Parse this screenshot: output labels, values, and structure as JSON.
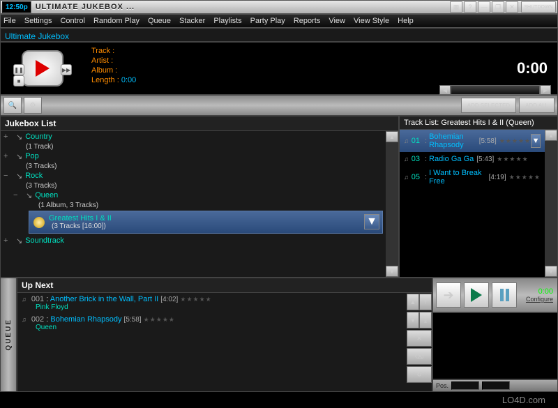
{
  "titlebar": {
    "clock": "12:50p",
    "app_title": "ULTIMATE JUKEBOX ...",
    "shutdown": "SHUTDOWN"
  },
  "menubar": {
    "items": [
      "File",
      "Settings",
      "Control",
      "Random Play",
      "Queue",
      "Stacker",
      "Playlists",
      "Party Play",
      "Reports",
      "View",
      "View Style",
      "Help"
    ]
  },
  "subbar": {
    "title": "Ultimate Jukebox"
  },
  "nowplaying": {
    "track_label": "Track :",
    "artist_label": "Artist :",
    "album_label": "Album :",
    "length_label": "Length :",
    "length_value": "0:00",
    "time_display": "0:00"
  },
  "toolbar": {
    "add_selected": "ADD SELECTED",
    "add_all": "ADD ALL"
  },
  "jukebox": {
    "header": "Jukebox List",
    "items": [
      {
        "name": "Country",
        "sub": "(1 Track)",
        "exp": "+"
      },
      {
        "name": "Pop",
        "sub": "(3 Tracks)",
        "exp": "+"
      },
      {
        "name": "Rock",
        "sub": "(3 Tracks)",
        "exp": "−"
      },
      {
        "name": "Queen",
        "sub": "(1 Album, 3 Tracks)",
        "exp": "−",
        "indent": 1
      },
      {
        "album": true,
        "name": "Greatest Hits I & II",
        "sub": "(3 Tracks [16:00])"
      },
      {
        "name": "Soundtrack",
        "sub": "",
        "exp": "+"
      }
    ]
  },
  "tracklist": {
    "header": "Track List: Greatest Hits I & II (Queen)",
    "tracks": [
      {
        "num": "01",
        "title": "Bohemian Rhapsody",
        "dur": "[5:58]",
        "sel": true
      },
      {
        "num": "03",
        "title": "Radio Ga Ga",
        "dur": "[5:43]",
        "sel": false
      },
      {
        "num": "05",
        "title": "I Want to Break Free",
        "dur": "[4:19]",
        "sel": false
      }
    ]
  },
  "upnext": {
    "header": "Up Next",
    "items": [
      {
        "num": "001",
        "title": "Another Brick in the Wall, Part II",
        "dur": "[4:02]",
        "artist": "Pink Floyd"
      },
      {
        "num": "002",
        "title": "Bohemian Rhapsody",
        "dur": "[5:58]",
        "artist": "Queen"
      }
    ]
  },
  "queue_label": "QUEUE",
  "bottom_right": {
    "time": "0:00",
    "configure": "Configure",
    "pos_label": "Pos."
  },
  "watermark": "LO4D.com",
  "stars": "★★★★★"
}
